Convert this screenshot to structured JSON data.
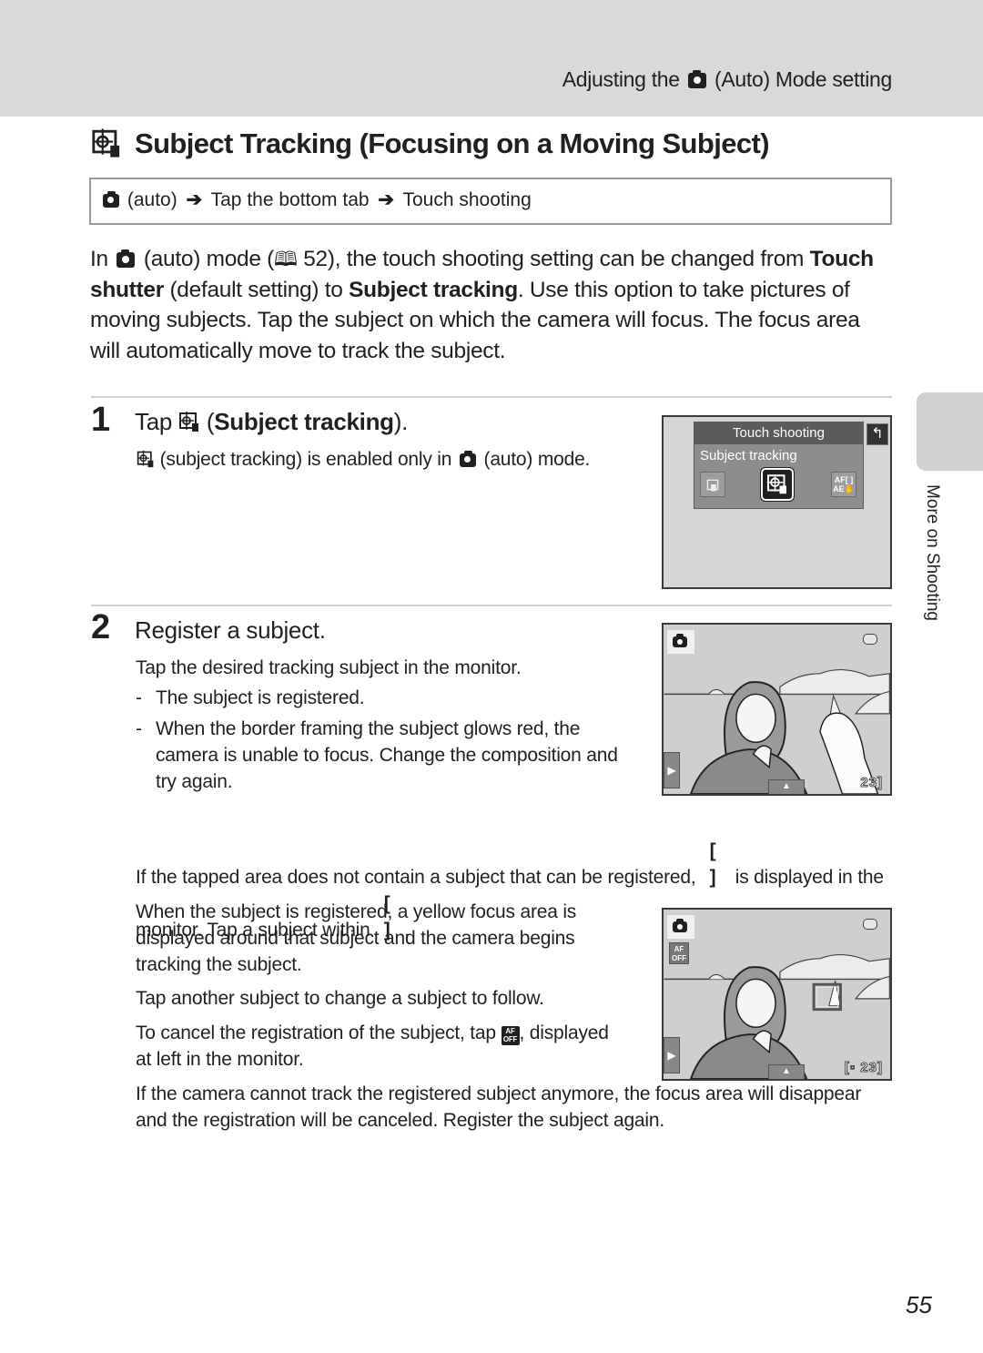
{
  "header": {
    "running_head_pre": "Adjusting the",
    "running_head_post": "(Auto) Mode setting",
    "running_head_icon": "auto-mode-camera-icon"
  },
  "title": {
    "icon": "subject-tracking-icon",
    "text": "Subject Tracking (Focusing on a Moving Subject)"
  },
  "nav_path": {
    "icon": "auto-mode-camera-icon",
    "parts": [
      "(auto)",
      "Tap the bottom tab",
      "Touch shooting"
    ],
    "separator": "➔"
  },
  "intro": {
    "t1": "In",
    "t2": "(auto) mode (",
    "book_icon": "🕮",
    "page_ref": "52), the touch shooting setting can be changed from",
    "bold1": "Touch shutter",
    "t3": "(default setting) to",
    "bold2": "Subject tracking",
    "t4": ". Use this option to take pictures of moving subjects. Tap the subject on which the camera will focus. The focus area will automatically move to track the subject."
  },
  "steps": [
    {
      "number": "1",
      "head_pre": "Tap",
      "head_bold": "Subject tracking",
      "head_open": "(",
      "head_close": ").",
      "note_1": "(subject tracking) is enabled only in",
      "note_2": "(auto) mode."
    },
    {
      "number": "2",
      "head": "Register a subject.",
      "lead": "Tap the desired tracking subject in the monitor.",
      "bullets": [
        "The subject is registered.",
        "When the border framing the subject glows red, the camera is unable to focus. Change the composition and try again."
      ]
    }
  ],
  "screen_menu": {
    "title": "Touch shooting",
    "selected_label": "Subject tracking",
    "options": [
      {
        "icon": "touch-shutter-icon",
        "label": "▫"
      },
      {
        "icon": "subject-tracking-icon",
        "label": ""
      },
      {
        "icon": "touch-af-ae-icon",
        "label": "AF[ ]\nAE"
      }
    ],
    "back_icon": "↰"
  },
  "screen_photo": {
    "counter_1": "23]",
    "counter_2": "[▫ 23]",
    "af_off_label": "AF\nOFF",
    "side_tab_glyph": "▶",
    "bottom_tab_glyph": "▲"
  },
  "paragraphs": {
    "no_subject_1": "If the tapped area does not contain a subject that can be registered,",
    "bracket": "[ ]",
    "no_subject_2": "is displayed in the monitor. Tap a subject within",
    "no_subject_3": ".",
    "registered": "When the subject is registered, a yellow focus area is displayed around that subject and the camera begins tracking the subject.",
    "change": "Tap another subject to change a subject to follow.",
    "cancel_1": "To cancel the registration of the subject, tap",
    "cancel_2": ", displayed at left in the monitor.",
    "lost": "If the camera cannot track the registered subject anymore, the focus area will disappear and the registration will be canceled. Register the subject again."
  },
  "side_tab": {
    "label": "More on Shooting"
  },
  "page_number": "55"
}
